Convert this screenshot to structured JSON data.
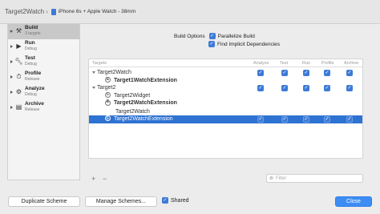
{
  "titlebar": {
    "scheme": "Target2Watch",
    "destination": "iPhone 6s + Apple Watch - 38mm"
  },
  "sidebar": {
    "items": [
      {
        "title": "Build",
        "subtitle": "3 targets",
        "icon": "hammer-icon",
        "selected": true
      },
      {
        "title": "Run",
        "subtitle": "Debug",
        "icon": "play-icon"
      },
      {
        "title": "Test",
        "subtitle": "Debug",
        "icon": "wrench-icon"
      },
      {
        "title": "Profile",
        "subtitle": "Release",
        "icon": "gauge-icon"
      },
      {
        "title": "Analyze",
        "subtitle": "Debug",
        "icon": "analyze-icon"
      },
      {
        "title": "Archive",
        "subtitle": "Release",
        "icon": "archive-icon"
      }
    ]
  },
  "build_options": {
    "label": "Build Options",
    "parallelize": "Parallelize Build",
    "implicit": "Find Implicit Dependencies"
  },
  "table": {
    "headers": [
      "Targets",
      "Analyze",
      "Test",
      "Run",
      "Profile",
      "Archive"
    ],
    "rows": [
      {
        "label": "Target2Watch",
        "type": "group"
      },
      {
        "label": "Target1WatchExtension",
        "type": "child-bold"
      },
      {
        "label": "Target2",
        "type": "group"
      },
      {
        "label": "Target2Widget",
        "type": "child"
      },
      {
        "label": "Target2WatchExtension",
        "type": "child-bold"
      },
      {
        "label_line1": "Target2Watch",
        "label_line2": "Target2WatchExtension",
        "type": "selected"
      }
    ]
  },
  "footer": {
    "add": "+",
    "remove": "−",
    "filter_placeholder": "Filter"
  },
  "bottom": {
    "duplicate": "Duplicate Scheme",
    "manage": "Manage Schemes...",
    "shared": "Shared",
    "close": "Close"
  },
  "colors": {
    "accent": "#3d8df5",
    "selection": "#2e72d2"
  }
}
